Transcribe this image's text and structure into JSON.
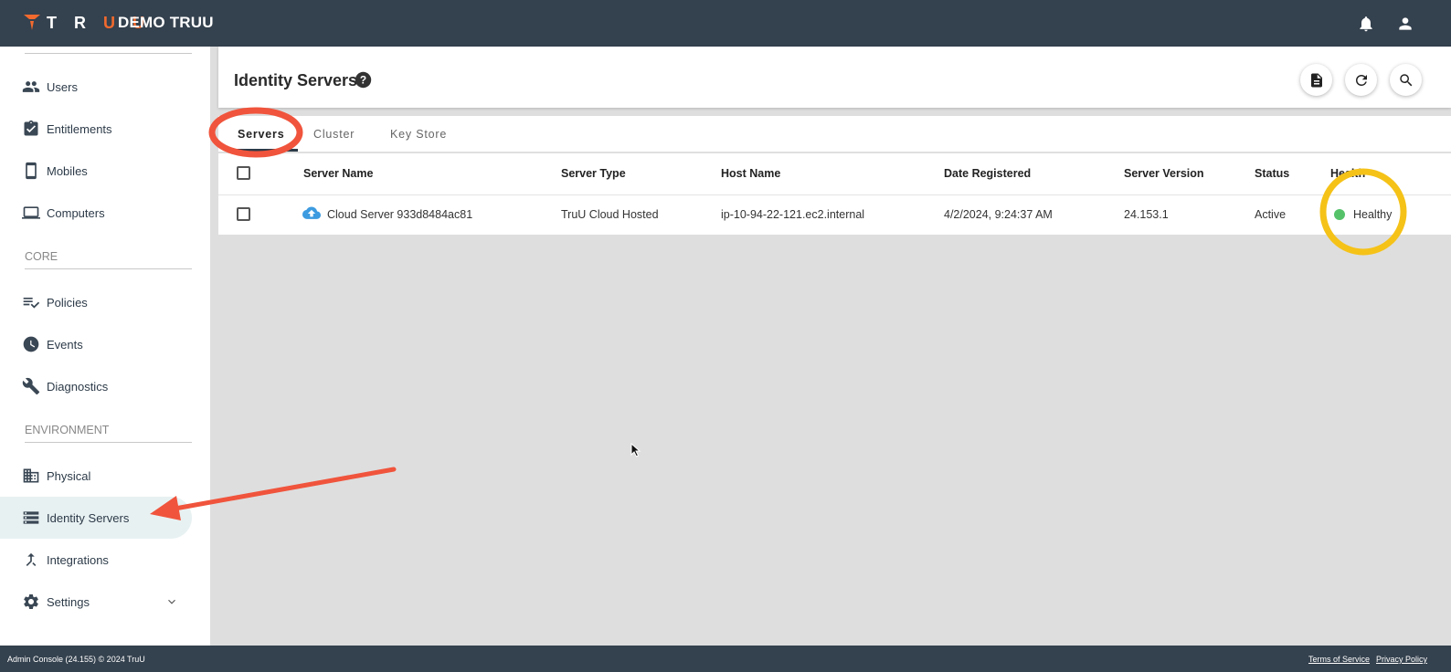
{
  "header": {
    "logo_text": "TRUU",
    "org_name": "DEMO TRUU",
    "icons": [
      "bell-icon",
      "account-icon"
    ]
  },
  "sidebar": {
    "items": [
      {
        "label": "Users",
        "icon": "users-icon"
      },
      {
        "label": "Entitlements",
        "icon": "assignment-check-icon"
      },
      {
        "label": "Mobiles",
        "icon": "mobile-phone-icon"
      },
      {
        "label": "Computers",
        "icon": "laptop-icon"
      },
      {
        "label": "Policies",
        "icon": "playlist-check-icon"
      },
      {
        "label": "Events",
        "icon": "clock-icon"
      },
      {
        "label": "Diagnostics",
        "icon": "wrench-icon"
      },
      {
        "label": "Physical",
        "icon": "building-icon"
      },
      {
        "label": "Identity Servers",
        "icon": "server-list-icon",
        "active": true
      },
      {
        "label": "Integrations",
        "icon": "merge-icon"
      },
      {
        "label": "Settings",
        "icon": "gear-icon"
      }
    ],
    "sections": {
      "core": "CORE",
      "environment": "ENVIRONMENT"
    }
  },
  "main": {
    "title": "Identity Servers",
    "actions": [
      "document-icon",
      "refresh-icon",
      "search-icon"
    ],
    "tabs": [
      {
        "label": "Servers",
        "active": true
      },
      {
        "label": "Cluster"
      },
      {
        "label": "Key Store"
      }
    ],
    "table": {
      "columns": [
        "Server Name",
        "Server Type",
        "Host Name",
        "Date Registered",
        "Server Version",
        "Status",
        "Health"
      ],
      "rows": [
        {
          "server_name": "Cloud Server 933d8484ac81",
          "server_type": "TruU Cloud Hosted",
          "host_name": "ip-10-94-22-121.ec2.internal",
          "date_registered": "4/2/2024, 9:24:37 AM",
          "server_version": "24.153.1",
          "status": "Active",
          "health": "Healthy"
        }
      ]
    }
  },
  "colors": {
    "topbar": "#34414e",
    "brand_orange": "#f26a2e",
    "healthy": "#55c26a",
    "annotation_red": "#f0543c",
    "annotation_yellow": "#f5c218"
  },
  "footer": {
    "left": "Admin Console (24.155) © 2024 TruU",
    "terms": "Terms of Service",
    "privacy": "Privacy Policy"
  }
}
